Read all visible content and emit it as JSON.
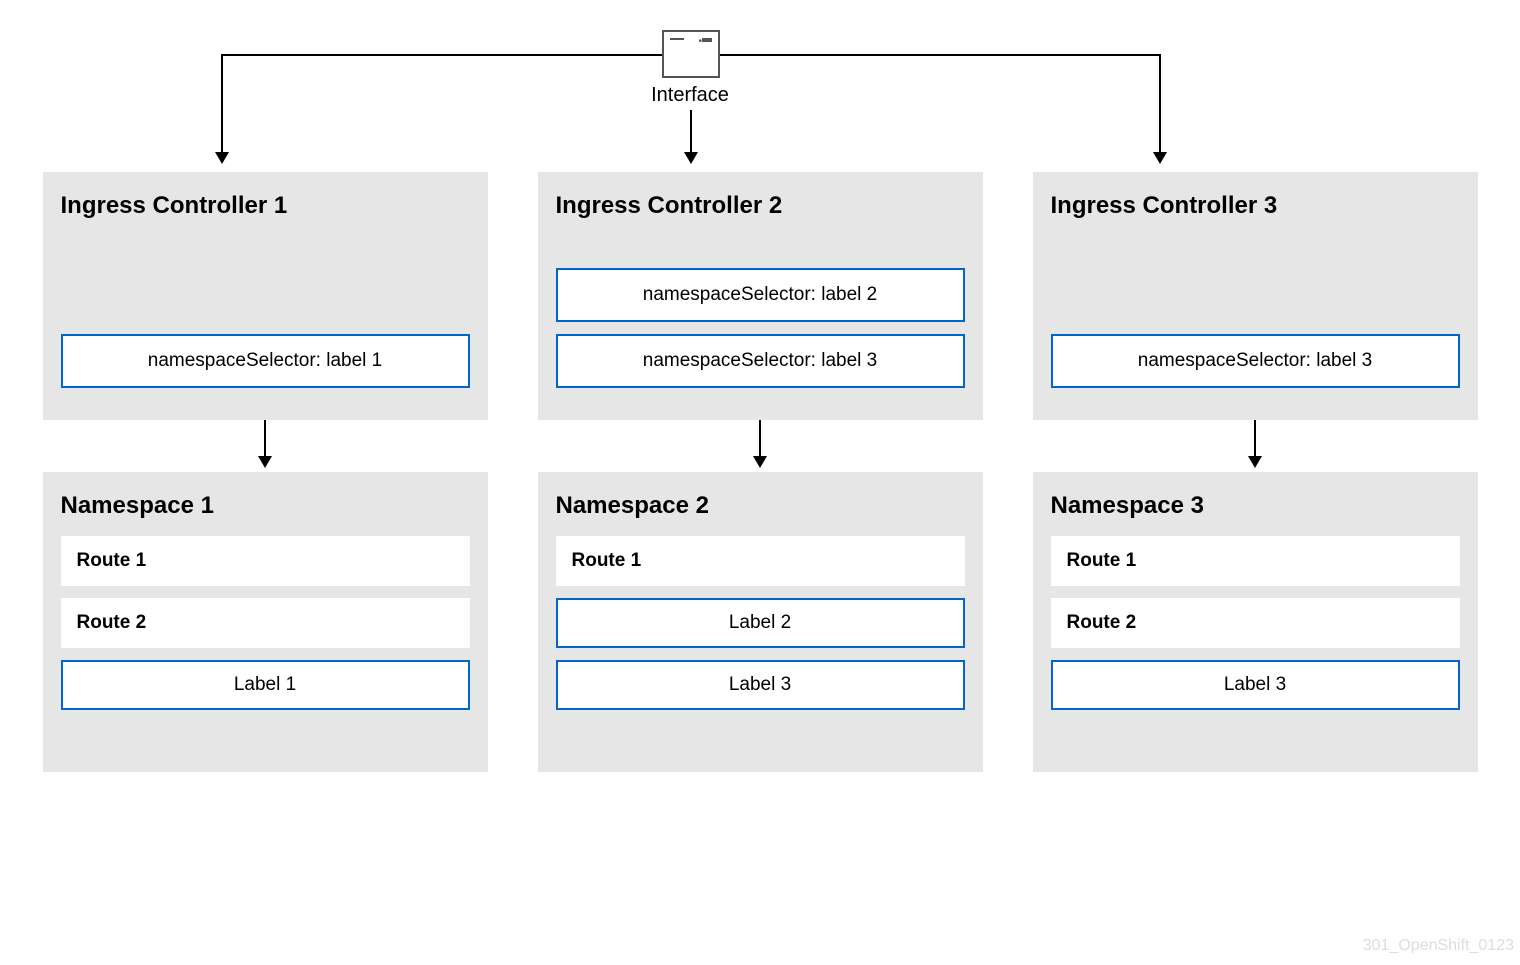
{
  "interface": {
    "label": "Interface"
  },
  "controllers": [
    {
      "title": "Ingress Controller 1",
      "selectors": [
        "namespaceSelector: label 1"
      ]
    },
    {
      "title": "Ingress Controller 2",
      "selectors": [
        "namespaceSelector: label 2",
        "namespaceSelector: label 3"
      ]
    },
    {
      "title": "Ingress Controller 3",
      "selectors": [
        "namespaceSelector: label 3"
      ]
    }
  ],
  "namespaces": [
    {
      "title": "Namespace 1",
      "routes": [
        "Route 1",
        "Route 2"
      ],
      "labels": [
        "Label 1"
      ]
    },
    {
      "title": "Namespace 2",
      "routes": [
        "Route 1"
      ],
      "labels": [
        "Label 2",
        "Label 3"
      ]
    },
    {
      "title": "Namespace 3",
      "routes": [
        "Route 1",
        "Route 2"
      ],
      "labels": [
        "Label 3"
      ]
    }
  ],
  "watermark": "301_OpenShift_0123"
}
